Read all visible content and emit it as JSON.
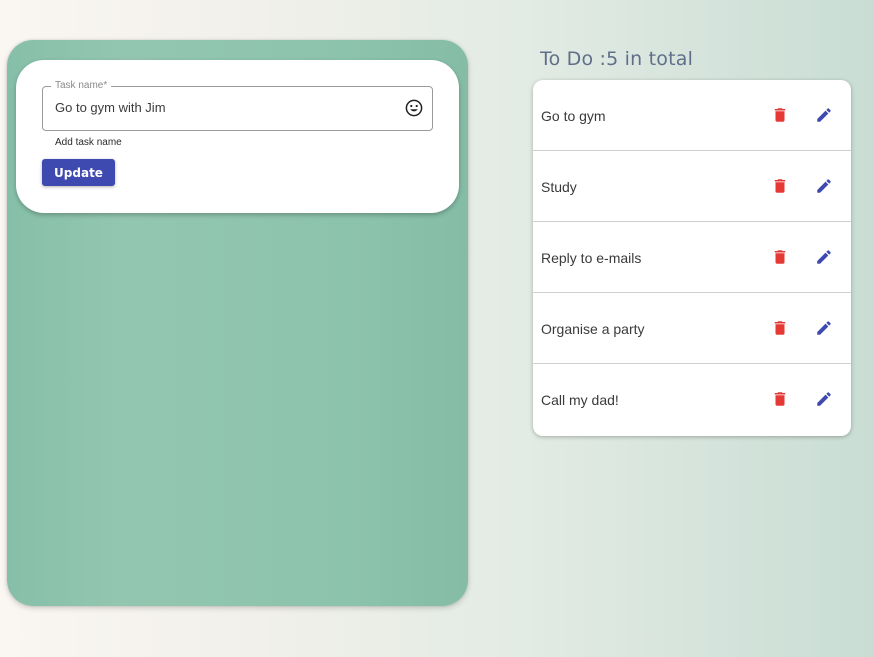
{
  "colors": {
    "panel_green": "#8cc3ad",
    "primary": "#3f4ab0",
    "delete": "#e53935",
    "title": "#5f6f8a"
  },
  "form": {
    "legend": "Task name*",
    "value": "Go to gym with Jim",
    "hint": "Add task name",
    "emoji_icon": "smiley-icon",
    "update_label": "Update"
  },
  "todo": {
    "title": "To Do :5 in total",
    "delete_icon": "trash-icon",
    "edit_icon": "pencil-icon",
    "items": [
      {
        "label": "Go to gym"
      },
      {
        "label": "Study"
      },
      {
        "label": "Reply to e-mails"
      },
      {
        "label": "Organise a party"
      },
      {
        "label": "Call my dad!"
      }
    ]
  }
}
